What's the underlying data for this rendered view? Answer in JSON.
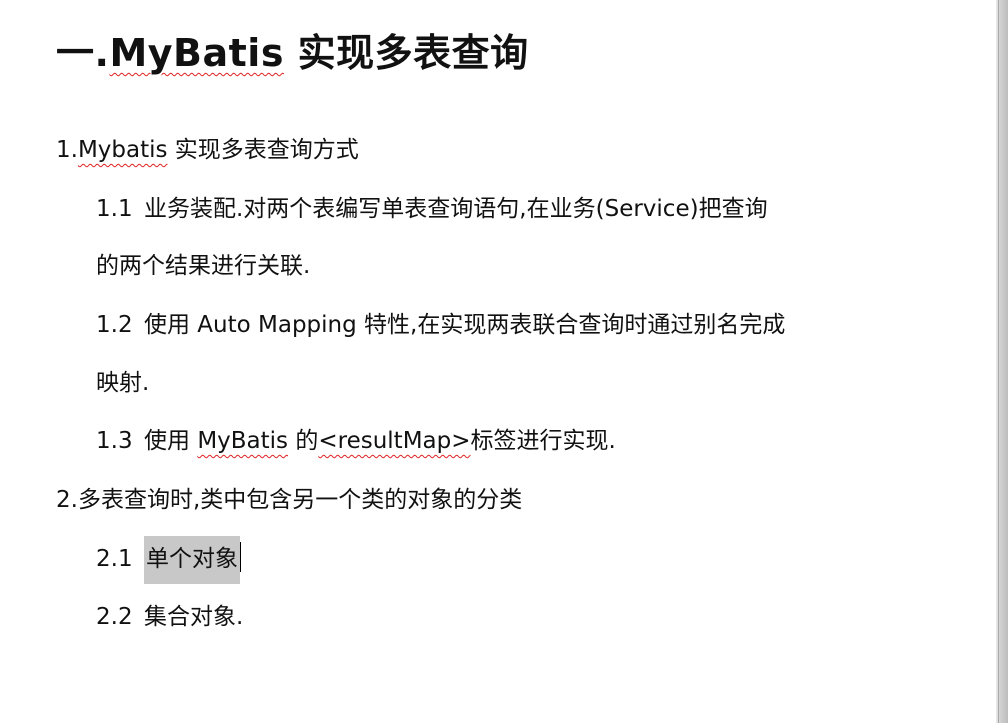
{
  "document": {
    "title": {
      "prefix": "一.",
      "brand": "MyBatis",
      "rest": " 实现多表查询"
    },
    "sections": {
      "s1": {
        "num": "1.",
        "brand": "Mybatis",
        "rest": " 实现多表查询方式"
      },
      "s1_1": {
        "num": "1.1",
        "text": "业务装配.对两个表编写单表查询语句,在业务(Service)把查询",
        "cont": "的两个结果进行关联."
      },
      "s1_2": {
        "num": "1.2",
        "text": "使用 Auto Mapping 特性,在实现两表联合查询时通过别名完成",
        "cont": "映射."
      },
      "s1_3": {
        "num": "1.3",
        "pre": "使用 ",
        "brand": "MyBatis",
        "mid": " 的",
        "tag": "<resultMap>",
        "post": "标签进行实现."
      },
      "s2": {
        "text": "2.多表查询时,类中包含另一个类的对象的分类"
      },
      "s2_1": {
        "num": "2.1",
        "text": "单个对象"
      },
      "s2_2": {
        "num": "2.2",
        "text": "集合对象."
      }
    }
  },
  "colors": {
    "text": "#111111",
    "spell_underline": "#e02020",
    "selection": "#c8c8c8"
  }
}
